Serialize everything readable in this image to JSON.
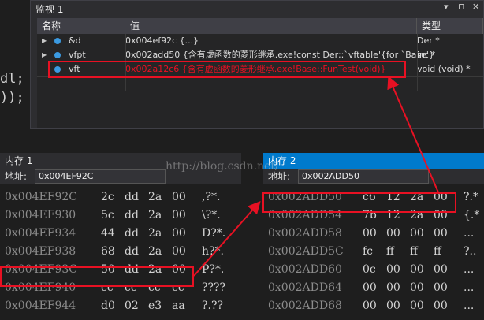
{
  "code_fragments": [
    "dl;",
    "));"
  ],
  "watch": {
    "title": "监视 1",
    "controls": [
      "▾",
      "⊓",
      "✕"
    ],
    "columns": [
      "名称",
      "值",
      "类型"
    ],
    "rows": [
      {
        "name": "&d",
        "value": "0x004ef92c {...}",
        "type": "Der *"
      },
      {
        "name": "vfpt",
        "value": "0x002add50 {含有虚函数的菱形继承.exe!const Der::`vftable'{for `Base'}",
        "type": "int *"
      },
      {
        "name": "vft",
        "value": "0x002a12c6 {含有虚函数的菱形继承.exe!Base::FunTest(void)}",
        "type": "void (void) *"
      }
    ]
  },
  "memory1": {
    "title": "内存 1",
    "address_label": "地址:",
    "address_value": "0x004EF92C",
    "rows": [
      {
        "addr": "0x004EF92C",
        "bytes": [
          "2c",
          "dd",
          "2a",
          "00"
        ],
        "ascii": ",?*."
      },
      {
        "addr": "0x004EF930",
        "bytes": [
          "5c",
          "dd",
          "2a",
          "00"
        ],
        "ascii": "\\?*."
      },
      {
        "addr": "0x004EF934",
        "bytes": [
          "44",
          "dd",
          "2a",
          "00"
        ],
        "ascii": "D?*."
      },
      {
        "addr": "0x004EF938",
        "bytes": [
          "68",
          "dd",
          "2a",
          "00"
        ],
        "ascii": "h?*."
      },
      {
        "addr": "0x004EF93C",
        "bytes": [
          "50",
          "dd",
          "2a",
          "00"
        ],
        "ascii": "P?*."
      },
      {
        "addr": "0x004EF940",
        "bytes": [
          "cc",
          "cc",
          "cc",
          "cc"
        ],
        "ascii": "????"
      },
      {
        "addr": "0x004EF944",
        "bytes": [
          "d0",
          "02",
          "e3",
          "aa"
        ],
        "ascii": "?.??"
      }
    ]
  },
  "memory2": {
    "title": "内存 2",
    "address_label": "地址:",
    "address_value": "0x002ADD50",
    "rows": [
      {
        "addr": "0x002ADD50",
        "bytes": [
          "c6",
          "12",
          "2a",
          "00"
        ],
        "ascii": "?.*"
      },
      {
        "addr": "0x002ADD54",
        "bytes": [
          "7b",
          "12",
          "2a",
          "00"
        ],
        "ascii": "{.*"
      },
      {
        "addr": "0x002ADD58",
        "bytes": [
          "00",
          "00",
          "00",
          "00"
        ],
        "ascii": "..."
      },
      {
        "addr": "0x002ADD5C",
        "bytes": [
          "fc",
          "ff",
          "ff",
          "ff"
        ],
        "ascii": "?.."
      },
      {
        "addr": "0x002ADD60",
        "bytes": [
          "0c",
          "00",
          "00",
          "00"
        ],
        "ascii": "..."
      },
      {
        "addr": "0x002ADD64",
        "bytes": [
          "00",
          "00",
          "00",
          "00"
        ],
        "ascii": "..."
      },
      {
        "addr": "0x002ADD68",
        "bytes": [
          "00",
          "00",
          "00",
          "00"
        ],
        "ascii": "..."
      }
    ]
  },
  "watermark": "http://blog.csdn.net/",
  "colors": {
    "highlight": "#e81123",
    "active_title": "#007acc",
    "value_red": "#e81123"
  }
}
